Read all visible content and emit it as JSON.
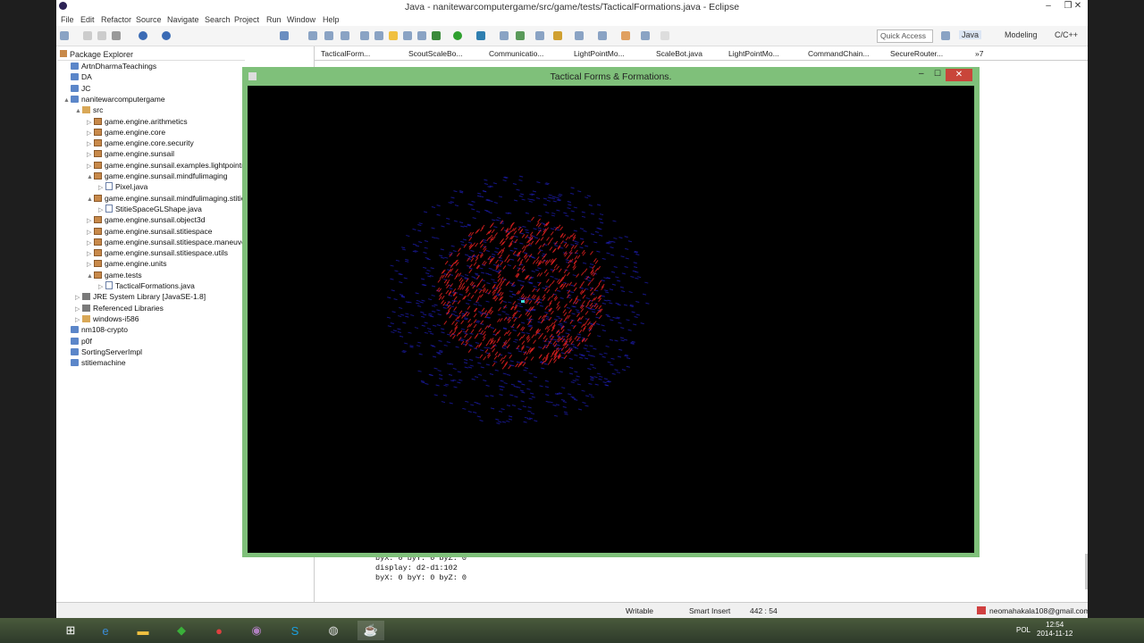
{
  "window": {
    "title": "Java - nanitewarcomputergame/src/game/tests/TacticalFormations.java - Eclipse"
  },
  "menu": [
    "File",
    "Edit",
    "Refactor",
    "Source",
    "Navigate",
    "Search",
    "Project",
    "Run",
    "Window",
    "Help"
  ],
  "toolbar": {
    "quick_access": "Quick Access",
    "perspectives": [
      "Java",
      "Modeling",
      "C/C++"
    ]
  },
  "package_explorer": {
    "title": "Package Explorer",
    "items": [
      {
        "label": "ArtnDharmaTeachings",
        "indent": 0,
        "icon": "proj",
        "arrow": ""
      },
      {
        "label": "DA",
        "indent": 0,
        "icon": "proj",
        "arrow": ""
      },
      {
        "label": "JC",
        "indent": 0,
        "icon": "proj",
        "arrow": ""
      },
      {
        "label": "nanitewarcomputergame",
        "indent": 0,
        "icon": "proj",
        "arrow": "▲"
      },
      {
        "label": "src",
        "indent": 1,
        "icon": "src",
        "arrow": "▲"
      },
      {
        "label": "game.engine.arithmetics",
        "indent": 2,
        "icon": "pkg",
        "arrow": "▷"
      },
      {
        "label": "game.engine.core",
        "indent": 2,
        "icon": "pkg",
        "arrow": "▷"
      },
      {
        "label": "game.engine.core.security",
        "indent": 2,
        "icon": "pkg",
        "arrow": "▷"
      },
      {
        "label": "game.engine.sunsail",
        "indent": 2,
        "icon": "pkg",
        "arrow": "▷"
      },
      {
        "label": "game.engine.sunsail.examples.lightpointr",
        "indent": 2,
        "icon": "pkg",
        "arrow": "▷"
      },
      {
        "label": "game.engine.sunsail.mindfulimaging",
        "indent": 2,
        "icon": "pkg",
        "arrow": "▲"
      },
      {
        "label": "Pixel.java",
        "indent": 3,
        "icon": "java",
        "arrow": "▷"
      },
      {
        "label": "game.engine.sunsail.mindfulimaging.stitie",
        "indent": 2,
        "icon": "pkg",
        "arrow": "▲"
      },
      {
        "label": "StitieSpaceGLShape.java",
        "indent": 3,
        "icon": "java",
        "arrow": "▷"
      },
      {
        "label": "game.engine.sunsail.object3d",
        "indent": 2,
        "icon": "pkg",
        "arrow": "▷"
      },
      {
        "label": "game.engine.sunsail.stitiespace",
        "indent": 2,
        "icon": "pkg",
        "arrow": "▷"
      },
      {
        "label": "game.engine.sunsail.stitiespace.maneuve",
        "indent": 2,
        "icon": "pkg",
        "arrow": "▷"
      },
      {
        "label": "game.engine.sunsail.stitiespace.utils",
        "indent": 2,
        "icon": "pkg",
        "arrow": "▷"
      },
      {
        "label": "game.engine.units",
        "indent": 2,
        "icon": "pkg",
        "arrow": "▷"
      },
      {
        "label": "game.tests",
        "indent": 2,
        "icon": "pkg",
        "arrow": "▲"
      },
      {
        "label": "TacticalFormations.java",
        "indent": 3,
        "icon": "java",
        "arrow": "▷"
      },
      {
        "label": "JRE System Library [JavaSE-1.8]",
        "indent": 1,
        "icon": "lib",
        "arrow": "▷"
      },
      {
        "label": "Referenced Libraries",
        "indent": 1,
        "icon": "lib",
        "arrow": "▷"
      },
      {
        "label": "windows-i586",
        "indent": 1,
        "icon": "src",
        "arrow": "▷"
      },
      {
        "label": "nm108-crypto",
        "indent": 0,
        "icon": "proj",
        "arrow": ""
      },
      {
        "label": "p0f",
        "indent": 0,
        "icon": "proj",
        "arrow": ""
      },
      {
        "label": "SortingServerImpl",
        "indent": 0,
        "icon": "proj",
        "arrow": ""
      },
      {
        "label": "stitiemachine",
        "indent": 0,
        "icon": "proj",
        "arrow": ""
      }
    ]
  },
  "editor_tabs": [
    "TacticalForm...",
    "ScoutScaleBo...",
    "Communicatio...",
    "LightPointMo...",
    "ScaleBot.java",
    "LightPointMo...",
    "CommandChain...",
    "SecureRouter...",
    "»7"
  ],
  "java_window": {
    "title": "Tactical Forms & Formations."
  },
  "console": {
    "lines": [
      "byX: 0 byY: 0 byZ: 0",
      "display: d2-d1:102",
      "byX: 0 byY: 0 byZ: 0"
    ]
  },
  "status": {
    "writable": "Writable",
    "insert": "Smart Insert",
    "position": "442 : 54",
    "user": "neomahakala108@gmail.com"
  },
  "taskbar": {
    "time": "12:54",
    "date": "2014-11-12",
    "lang": "POL"
  },
  "colors": {
    "java_frame": "#7fc07a",
    "close_button": "#c9453a",
    "points_red": "#e02020",
    "points_blue": "#2020c0"
  }
}
